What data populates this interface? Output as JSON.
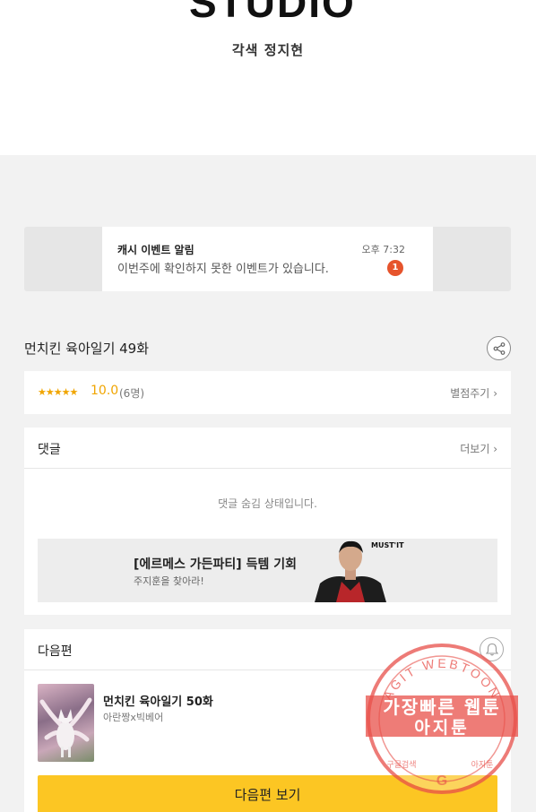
{
  "header": {
    "logo_text": "STUDIO",
    "credit": "각색 정지현"
  },
  "notification": {
    "title": "캐시 이벤트 알림",
    "message": "이번주에 확인하지 못한 이벤트가 있습니다.",
    "time": "오후 7:32",
    "count": "1"
  },
  "episode": {
    "title": "먼치킨 육아일기 49화",
    "share_icon": "share-icon"
  },
  "rating": {
    "stars": "★★★★★",
    "score": "10.0",
    "votes": "(6명)",
    "rate_label": "별점주기",
    "rate_chevron": "›"
  },
  "comments": {
    "title": "댓글",
    "more_label": "더보기",
    "more_chevron": "›",
    "hidden_notice": "댓글 숨김 상태입니다."
  },
  "ad": {
    "title": "[에르메스 가든파티] 득템 기회",
    "subtitle": "주지훈을 찾아라!",
    "brand": "MUST'IT"
  },
  "next": {
    "label": "다음편",
    "episode_title": "먼치킨 육아일기 50화",
    "authors": "아란짱x빅베어",
    "button_label": "다음편 보기"
  },
  "watermark": {
    "arc_text": "AGIT WEBTOON",
    "line1": "가장빠른 웹툰",
    "line2": "아지툰",
    "bottom_text": "구글검색",
    "bottom_right": "아지툰",
    "g": "G"
  },
  "colors": {
    "accent_yellow": "#fcc623",
    "star": "#f0a500",
    "badge_red": "#e6542c",
    "watermark_red": "#e8504a"
  }
}
